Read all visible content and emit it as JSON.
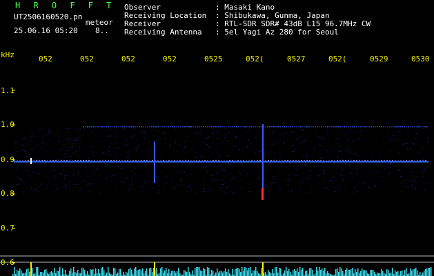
{
  "header": {
    "station_code": "H R O F F T",
    "filename": "UT2506160520.pn",
    "category": "meteor",
    "datetime": "25.06.16 05:20",
    "counter": "8.."
  },
  "info": {
    "labels": [
      "Observer",
      "Receiving Location",
      "Receiver",
      "Receiving Antenna"
    ],
    "values": [
      ": Masaki Kano",
      ": Shibukawa, Gunma, Japan",
      ": RTL-SDR SDR# 43dB L15 96.7MHz CW",
      ": 5el Yagi Az 280 for Seoul"
    ]
  },
  "time_axis": {
    "ticks": [
      "052",
      "052",
      "052",
      "052",
      "0525",
      "052(",
      "0527",
      "052(",
      "0529",
      "0530"
    ]
  },
  "freq_axis": {
    "unit": "kHz",
    "ticks": [
      "1.1",
      "1.0",
      "0.9",
      "0.8",
      "0.7",
      "0.6"
    ]
  },
  "colors": {
    "background": "#000000",
    "signal": "#3a5cff",
    "bright": "#ffffff",
    "meteor_red": "#ff3030",
    "histogram": "#38d8e8",
    "axis_text": "#f0f000",
    "title_text": "#4cff4c"
  }
}
